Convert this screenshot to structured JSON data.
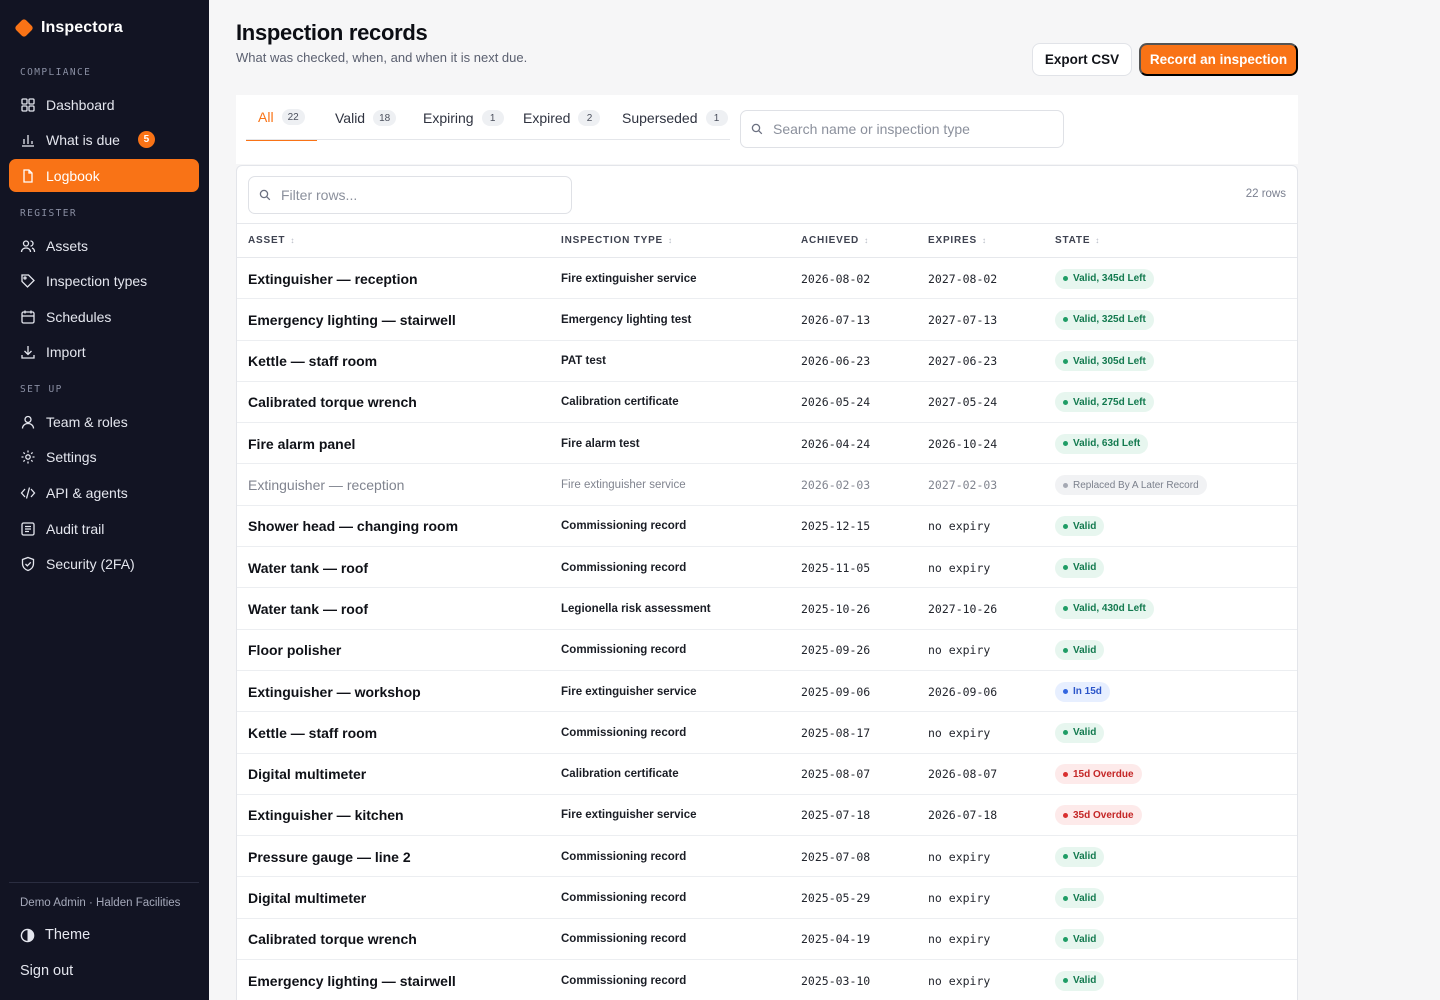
{
  "app": {
    "name": "Inspectora",
    "brand_color": "#f97316",
    "sidebar_bg": "#121423"
  },
  "sidebar": {
    "sections": [
      {
        "label": "COMPLIANCE",
        "items": [
          {
            "label": "Dashboard",
            "icon": "grid-icon"
          },
          {
            "label": "What is due",
            "icon": "bar-chart-icon",
            "badge": "5"
          },
          {
            "label": "Logbook",
            "icon": "file-icon",
            "active": true
          }
        ]
      },
      {
        "label": "REGISTER",
        "items": [
          {
            "label": "Assets",
            "icon": "users-icon"
          },
          {
            "label": "Inspection types",
            "icon": "tag-icon"
          },
          {
            "label": "Schedules",
            "icon": "calendar-icon"
          },
          {
            "label": "Import",
            "icon": "download-icon"
          }
        ]
      },
      {
        "label": "SET UP",
        "items": [
          {
            "label": "Team & roles",
            "icon": "user-icon"
          },
          {
            "label": "Settings",
            "icon": "gear-icon"
          },
          {
            "label": "API & agents",
            "icon": "code-icon"
          },
          {
            "label": "Audit trail",
            "icon": "list-icon"
          },
          {
            "label": "Security (2FA)",
            "icon": "shield-icon"
          }
        ]
      }
    ],
    "user": "Demo Admin · Halden Facilities",
    "theme_label": "Theme",
    "signout_label": "Sign out"
  },
  "header": {
    "title": "Inspection records",
    "subtitle": "What was checked, when, and when it is next due.",
    "export_label": "Export CSV",
    "record_label": "Record an inspection"
  },
  "tabs": [
    {
      "label": "All",
      "count": "22",
      "active": true
    },
    {
      "label": "Valid",
      "count": "18"
    },
    {
      "label": "Expiring",
      "count": "1"
    },
    {
      "label": "Expired",
      "count": "2"
    },
    {
      "label": "Superseded",
      "count": "1"
    }
  ],
  "search": {
    "placeholder": "Search name or inspection type"
  },
  "table": {
    "filter_placeholder": "Filter rows...",
    "rows_label": "22 rows",
    "columns": [
      "ASSET",
      "INSPECTION TYPE",
      "ACHIEVED",
      "EXPIRES",
      "STATE"
    ],
    "rows": [
      {
        "asset": "Extinguisher — reception",
        "type": "Fire extinguisher service",
        "achieved": "2026-08-02",
        "expires": "2027-08-02",
        "state": "Valid, 345d Left",
        "kind": "valid"
      },
      {
        "asset": "Emergency lighting — stairwell",
        "type": "Emergency lighting test",
        "achieved": "2026-07-13",
        "expires": "2027-07-13",
        "state": "Valid, 325d Left",
        "kind": "valid"
      },
      {
        "asset": "Kettle — staff room",
        "type": "PAT test",
        "achieved": "2026-06-23",
        "expires": "2027-06-23",
        "state": "Valid, 305d Left",
        "kind": "valid"
      },
      {
        "asset": "Calibrated torque wrench",
        "type": "Calibration certificate",
        "achieved": "2026-05-24",
        "expires": "2027-05-24",
        "state": "Valid, 275d Left",
        "kind": "valid"
      },
      {
        "asset": "Fire alarm panel",
        "type": "Fire alarm test",
        "achieved": "2026-04-24",
        "expires": "2026-10-24",
        "state": "Valid, 63d Left",
        "kind": "valid"
      },
      {
        "asset": "Extinguisher — reception",
        "type": "Fire extinguisher service",
        "achieved": "2026-02-03",
        "expires": "2027-02-03",
        "state": "Replaced By A Later Record",
        "kind": "super"
      },
      {
        "asset": "Shower head — changing room",
        "type": "Commissioning record",
        "achieved": "2025-12-15",
        "expires": "no expiry",
        "state": "Valid",
        "kind": "valid"
      },
      {
        "asset": "Water tank — roof",
        "type": "Commissioning record",
        "achieved": "2025-11-05",
        "expires": "no expiry",
        "state": "Valid",
        "kind": "valid"
      },
      {
        "asset": "Water tank — roof",
        "type": "Legionella risk assessment",
        "achieved": "2025-10-26",
        "expires": "2027-10-26",
        "state": "Valid, 430d Left",
        "kind": "valid"
      },
      {
        "asset": "Floor polisher",
        "type": "Commissioning record",
        "achieved": "2025-09-26",
        "expires": "no expiry",
        "state": "Valid",
        "kind": "valid"
      },
      {
        "asset": "Extinguisher — workshop",
        "type": "Fire extinguisher service",
        "achieved": "2025-09-06",
        "expires": "2026-09-06",
        "state": "In 15d",
        "kind": "soon"
      },
      {
        "asset": "Kettle — staff room",
        "type": "Commissioning record",
        "achieved": "2025-08-17",
        "expires": "no expiry",
        "state": "Valid",
        "kind": "valid"
      },
      {
        "asset": "Digital multimeter",
        "type": "Calibration certificate",
        "achieved": "2025-08-07",
        "expires": "2026-08-07",
        "state": "15d Overdue",
        "kind": "overdue"
      },
      {
        "asset": "Extinguisher — kitchen",
        "type": "Fire extinguisher service",
        "achieved": "2025-07-18",
        "expires": "2026-07-18",
        "state": "35d Overdue",
        "kind": "overdue"
      },
      {
        "asset": "Pressure gauge — line 2",
        "type": "Commissioning record",
        "achieved": "2025-07-08",
        "expires": "no expiry",
        "state": "Valid",
        "kind": "valid"
      },
      {
        "asset": "Digital multimeter",
        "type": "Commissioning record",
        "achieved": "2025-05-29",
        "expires": "no expiry",
        "state": "Valid",
        "kind": "valid"
      },
      {
        "asset": "Calibrated torque wrench",
        "type": "Commissioning record",
        "achieved": "2025-04-19",
        "expires": "no expiry",
        "state": "Valid",
        "kind": "valid"
      },
      {
        "asset": "Emergency lighting — stairwell",
        "type": "Commissioning record",
        "achieved": "2025-03-10",
        "expires": "no expiry",
        "state": "Valid",
        "kind": "valid"
      }
    ]
  }
}
